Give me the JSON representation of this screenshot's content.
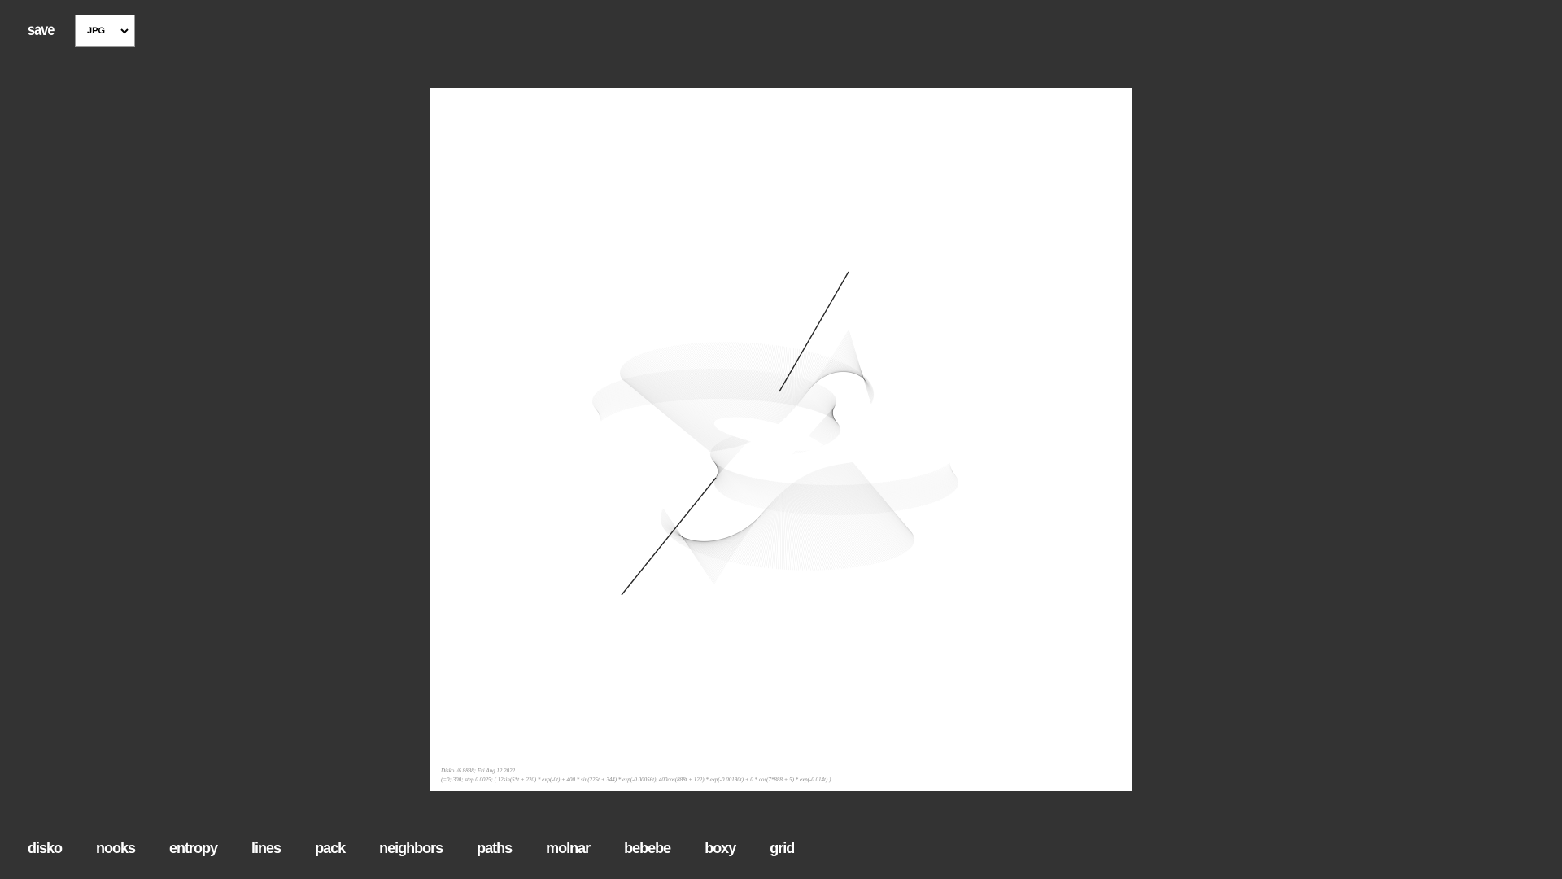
{
  "toolbar": {
    "save_label": "save",
    "format_select": {
      "selected": "JPG",
      "icon": "chevron-down-icon"
    }
  },
  "artwork": {
    "caption_line1": "Disko  /6 8888; Fri Aug 12 2022",
    "caption_line2": "(=0; 300; step 0.0025; ( 12sin(5*t + 220) * exp(-0t) + 400 * sin(225t + 344) * exp(-0.00056t), 400cos(888t + 122) * exp(-0.00180t) + 0 * cos(7*888 + 5) * exp(-0.014t) )"
  },
  "nav": {
    "items": [
      "disko",
      "nooks",
      "entropy",
      "lines",
      "pack",
      "neighbors",
      "paths",
      "molnar",
      "bebebe",
      "boxy",
      "grid"
    ]
  }
}
